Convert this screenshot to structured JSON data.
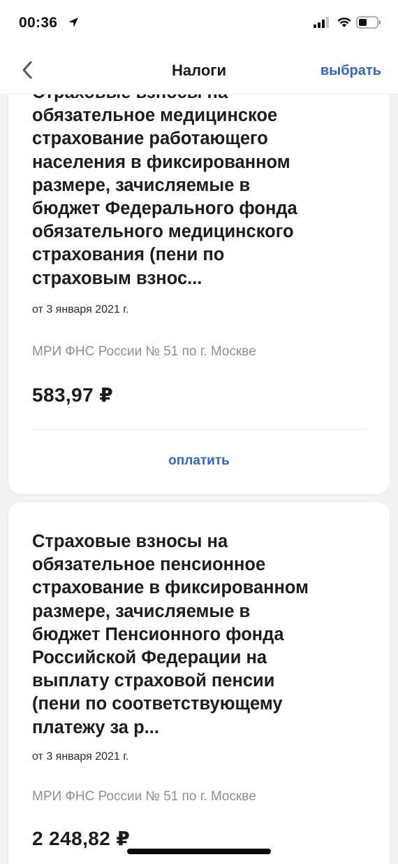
{
  "status_bar": {
    "time": "00:36",
    "location_icon": "location-arrow-icon",
    "signal_icon": "cellular-signal-icon",
    "wifi_icon": "wifi-icon",
    "battery_icon": "battery-icon"
  },
  "nav": {
    "back_icon": "chevron-left-icon",
    "title": "Налоги",
    "action_label": "выбрать"
  },
  "cards": [
    {
      "title_lines": [
        "Страховые взносы на",
        "обязательное медицинское",
        "страхование работающего",
        "населения в фиксированном",
        "размере, зачисляемые в",
        "бюджет Федерального фонда",
        "обязательного медицинского",
        "страхования (пени по",
        "страховым взнос..."
      ],
      "date": "от 3 января 2021 г.",
      "org": "МРИ ФНС России № 51 по г. Москве",
      "amount": "583,97 ₽",
      "pay_label": "оплатить"
    },
    {
      "title_lines": [
        "Страховые взносы на",
        "обязательное пенсионное",
        "страхование в фиксированном",
        "размере, зачисляемые в",
        "бюджет Пенсионного фонда",
        "Российской Федерации на",
        "выплату страховой пенсии",
        "(пени по соответствующему",
        "платежу за р..."
      ],
      "date": "от 3 января 2021 г.",
      "org": "МРИ ФНС России № 51 по г. Москве",
      "amount": "2 248,82 ₽"
    }
  ],
  "colors": {
    "accent": "#2f66c7",
    "background": "#f3f3f5",
    "card": "#ffffff",
    "secondary_text": "#8a8f99"
  }
}
